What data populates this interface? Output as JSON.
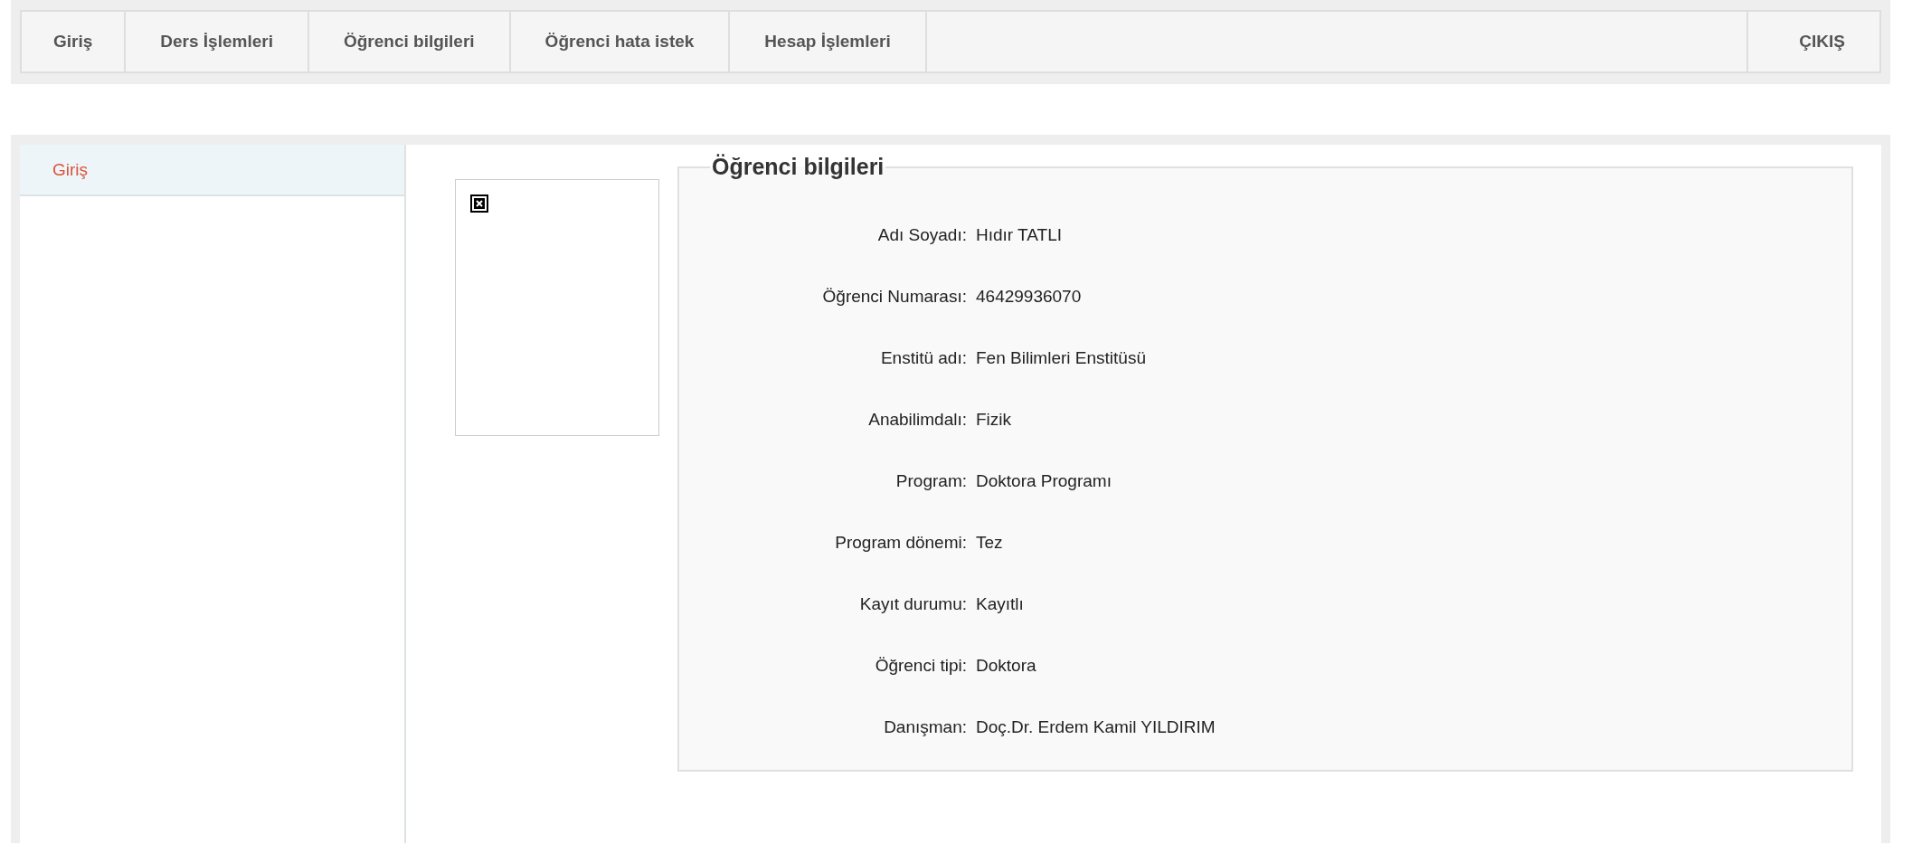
{
  "menu": {
    "items": [
      {
        "label": "Giriş"
      },
      {
        "label": "Ders İşlemleri"
      },
      {
        "label": "Öğrenci bilgileri"
      },
      {
        "label": "Öğrenci hata istek"
      },
      {
        "label": "Hesap İşlemleri"
      }
    ],
    "logout": "ÇIKIŞ"
  },
  "sidebar": {
    "items": [
      {
        "label": "Giriş",
        "selected": true
      }
    ]
  },
  "student_info": {
    "legend": "Öğrenci bilgileri",
    "fields": [
      {
        "label": "Adı Soyadı:",
        "value": "Hıdır TATLI"
      },
      {
        "label": "Öğrenci Numarası:",
        "value": "46429936070"
      },
      {
        "label": "Enstitü adı:",
        "value": "Fen Bilimleri Enstitüsü"
      },
      {
        "label": "Anabilimdalı:",
        "value": "Fizik"
      },
      {
        "label": "Program:",
        "value": "Doktora Programı"
      },
      {
        "label": "Program dönemi:",
        "value": "Tez"
      },
      {
        "label": "Kayıt durumu:",
        "value": "Kayıtlı"
      },
      {
        "label": "Öğrenci tipi:",
        "value": "Doktora"
      },
      {
        "label": "Danışman:",
        "value": "Doç.Dr. Erdem Kamil YILDIRIM"
      }
    ]
  }
}
